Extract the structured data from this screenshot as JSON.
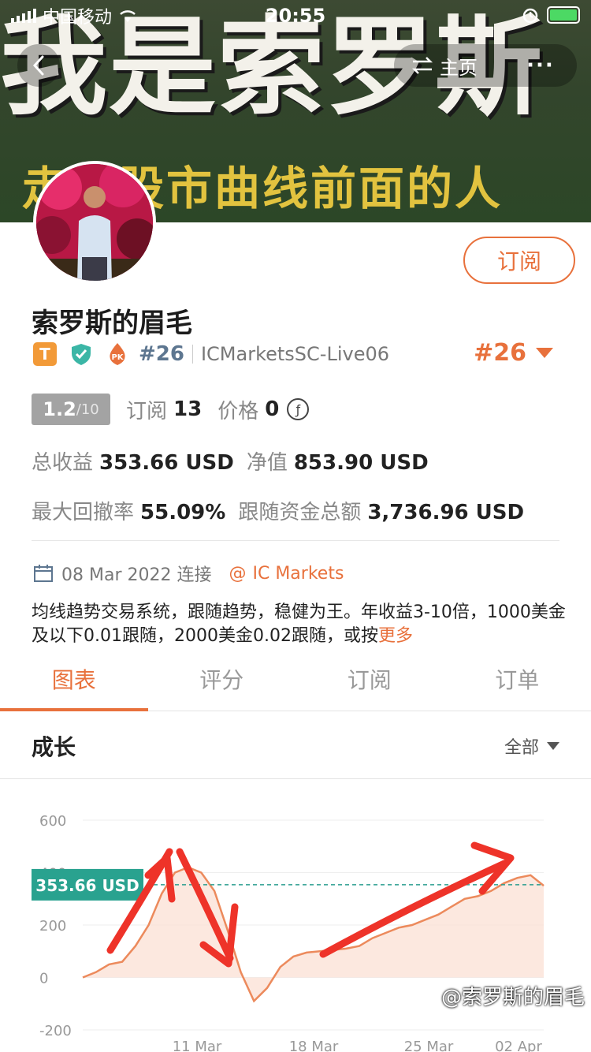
{
  "status_bar": {
    "carrier": "中国移动",
    "time": "20:55"
  },
  "banner": {
    "title": "我是索罗斯",
    "subtitle": "走在股市曲线前面的人"
  },
  "nav": {
    "home_label": "主页",
    "more_label": "···"
  },
  "profile": {
    "name": "索罗斯的眉毛",
    "subscribe_label": "订阅",
    "badge_t": "T",
    "badge_pk": "PK",
    "rank_small": "#26",
    "account": "ICMarketsSC-Live06",
    "rank_big": "#26"
  },
  "stats": {
    "score": "1.2",
    "score_max": "/10",
    "subs_label": "订阅",
    "subs_value": "13",
    "price_label": "价格",
    "price_value": "0",
    "price_symbol": "ƒ",
    "total_profit_label": "总收益",
    "total_profit_value": "353.66 USD",
    "net_value_label": "净值",
    "net_value_value": "853.90 USD",
    "max_drawdown_label": "最大回撤率",
    "max_drawdown_value": "55.09%",
    "follow_funds_label": "跟随资金总额",
    "follow_funds_value": "3,736.96 USD"
  },
  "connection": {
    "date": "08 Mar 2022 连接",
    "broker": "IC Markets"
  },
  "description": {
    "text": "均线趋势交易系统，跟随趋势，稳健为王。年收益3-10倍，1000美金及以下0.01跟随，2000美金0.02跟随，或按",
    "more": "更多"
  },
  "tabs": [
    {
      "label": "图表"
    },
    {
      "label": "评分"
    },
    {
      "label": "订阅"
    },
    {
      "label": "订单"
    }
  ],
  "growth": {
    "title": "成长",
    "filter": "全部"
  },
  "chart_data": {
    "type": "area",
    "y_ticks": [
      "600",
      "400",
      "200",
      "0",
      "-200"
    ],
    "ylim": [
      -200,
      600
    ],
    "x_tick_labels": [
      "11 Mar",
      "18 Mar",
      "25 Mar",
      "02 Apr"
    ],
    "current_label": "353.66 USD",
    "current_value": 353.66,
    "series": [
      {
        "values": [
          0,
          20,
          50,
          60,
          120,
          200,
          320,
          400,
          420,
          400,
          330,
          180,
          20,
          -90,
          -40,
          40,
          80,
          95,
          100,
          105,
          110,
          120,
          150,
          170,
          190,
          200,
          220,
          240,
          270,
          300,
          310,
          330,
          360,
          380,
          390,
          350
        ]
      }
    ]
  },
  "watermark": "@索罗斯的眉毛"
}
